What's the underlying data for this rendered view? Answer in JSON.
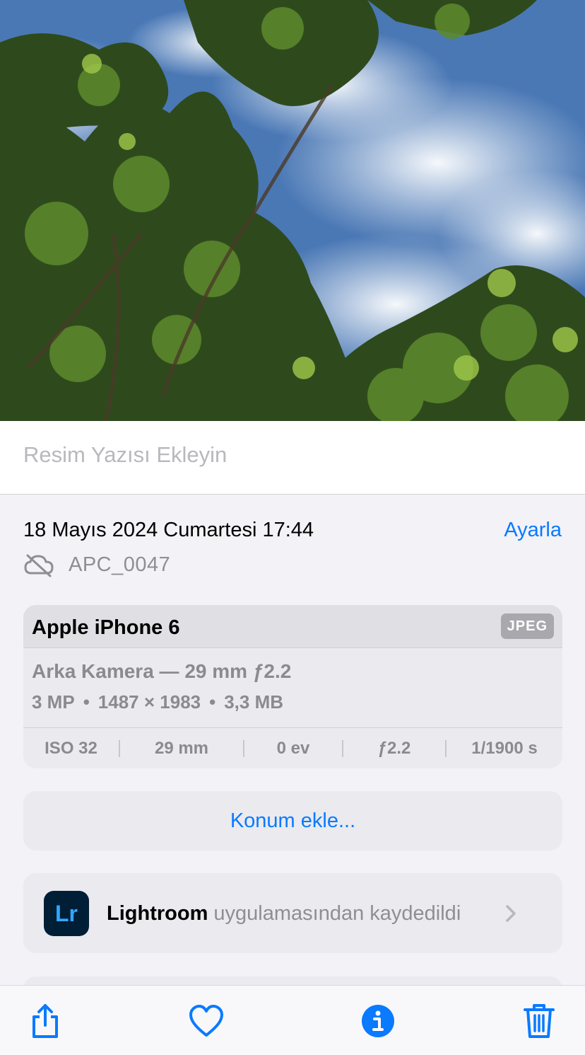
{
  "caption": {
    "placeholder": "Resim Yazısı Ekleyin"
  },
  "info": {
    "date": "18 Mayıs 2024 Cumartesi 17:44",
    "adjust_label": "Ayarla",
    "filename": "APC_0047"
  },
  "exif": {
    "device": "Apple iPhone 6",
    "format": "JPEG",
    "lens": "Arka Kamera — 29 mm ƒ2.2",
    "megapixels": "3 MP",
    "resolution": "1487 × 1983",
    "size": "3,3 MB",
    "dot": "•",
    "iso": "ISO 32",
    "focal": "29 mm",
    "ev": "0 ev",
    "aperture": "ƒ2.2",
    "shutter": "1/1900 s"
  },
  "location": {
    "label": "Konum ekle..."
  },
  "app": {
    "icon_text": "Lr",
    "name": "Lightroom",
    "suffix": " uygulamasından kaydedildi"
  },
  "icons": {
    "share": "share-icon",
    "favorite": "heart-icon",
    "info": "info-icon",
    "delete": "trash-icon",
    "cloud": "cloud-off-icon"
  },
  "colors": {
    "accent": "#0a7aff",
    "lightroom_bg": "#001e36",
    "lightroom_fg": "#31a8ff"
  }
}
